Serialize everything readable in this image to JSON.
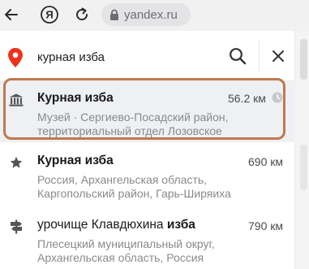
{
  "browser": {
    "url": "yandex.ru",
    "yandex_letter": "Я"
  },
  "search": {
    "query": "курная изба",
    "placeholder": "",
    "pin_color": "#f0311e"
  },
  "results": [
    {
      "icon": "museum-icon",
      "title": "Курная изба",
      "distance": "56.2 км",
      "subtitle": "Музей · Сергиево-Посадский район, территориальный отдел Лозовское",
      "history": true
    },
    {
      "icon": "star-icon",
      "title": "Курная изба",
      "distance": "690 км",
      "subtitle": "Россия, Архангельская область, Каргопольский район, Гарь-Ширяиха"
    },
    {
      "icon": "signpost-icon",
      "title_plain": "урочище Клавдюхина ",
      "title_bold": "изба",
      "distance": "790 км",
      "subtitle": "Плесецкий муниципальный округ, Архангельская область, Россия"
    }
  ],
  "colors": {
    "highlight": "#c0794e",
    "selected_bg": "#eef0f3"
  }
}
